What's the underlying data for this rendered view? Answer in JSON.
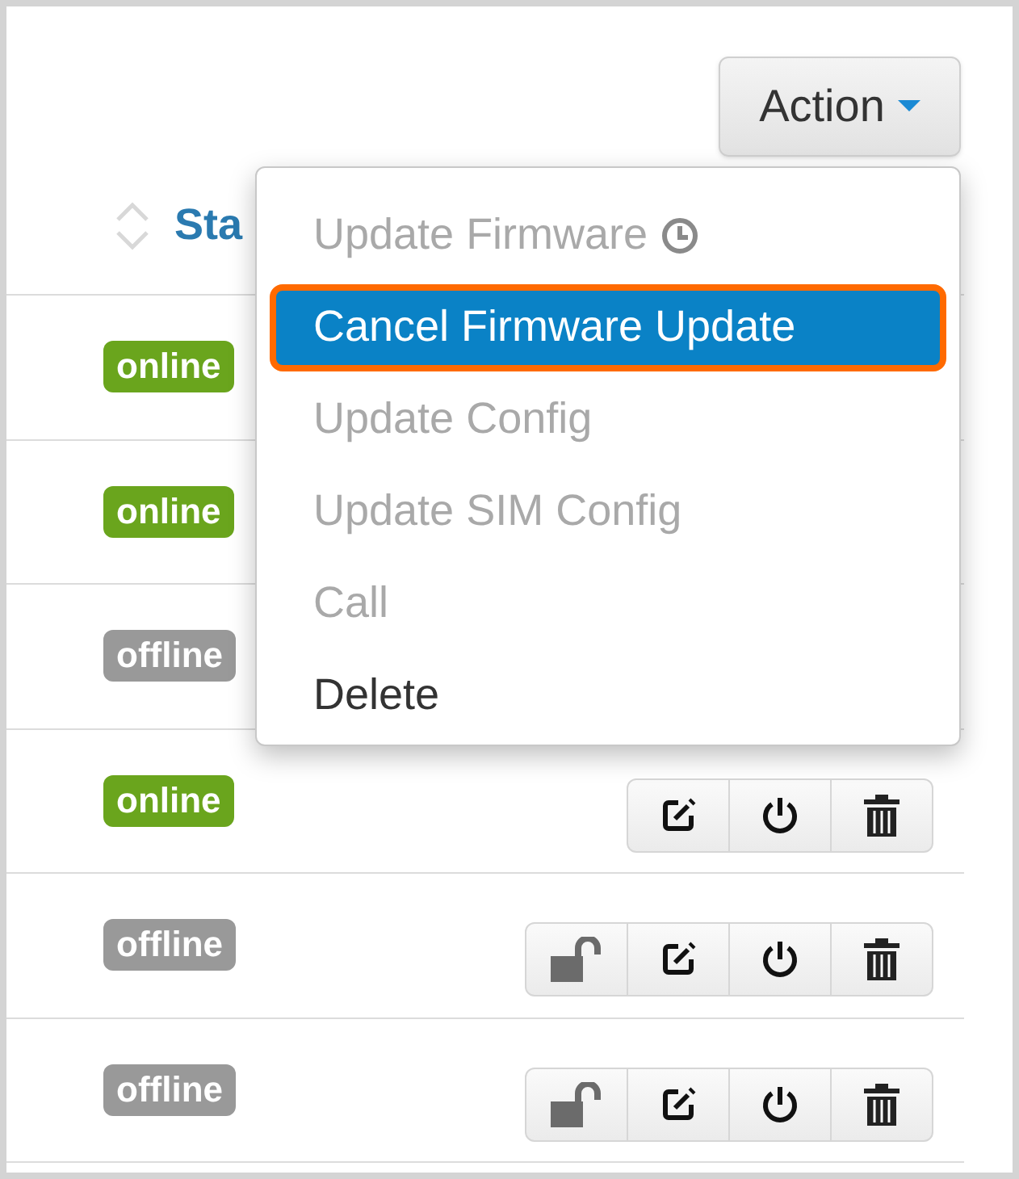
{
  "action_button": {
    "label": "Action"
  },
  "table": {
    "columns": [
      {
        "label": "Sta"
      }
    ],
    "rows": [
      {
        "status": "online",
        "color": "#6aa51d"
      },
      {
        "status": "online",
        "color": "#6aa51d"
      },
      {
        "status": "offline",
        "color": "#999999"
      },
      {
        "status": "online",
        "color": "#6aa51d",
        "buttons": [
          {
            "kind": "edit"
          },
          {
            "kind": "power"
          },
          {
            "kind": "delete"
          }
        ]
      },
      {
        "status": "offline",
        "color": "#999999",
        "buttons": [
          {
            "kind": "unlock"
          },
          {
            "kind": "edit"
          },
          {
            "kind": "power"
          },
          {
            "kind": "delete"
          }
        ]
      },
      {
        "status": "offline",
        "color": "#999999",
        "buttons": [
          {
            "kind": "unlock"
          },
          {
            "kind": "edit"
          },
          {
            "kind": "power"
          },
          {
            "kind": "delete"
          }
        ]
      }
    ]
  },
  "menu": {
    "items": [
      {
        "label": "Update Firmware",
        "kind": "scheduled",
        "disabled": true,
        "selected": false
      },
      {
        "label": "Cancel Firmware Update",
        "disabled": false,
        "selected": true
      },
      {
        "label": "Update Config",
        "disabled": true,
        "selected": false
      },
      {
        "label": "Update SIM Config",
        "disabled": true,
        "selected": false
      },
      {
        "label": "Call",
        "disabled": true,
        "selected": false
      },
      {
        "label": "Delete",
        "disabled": false,
        "selected": false
      }
    ]
  }
}
